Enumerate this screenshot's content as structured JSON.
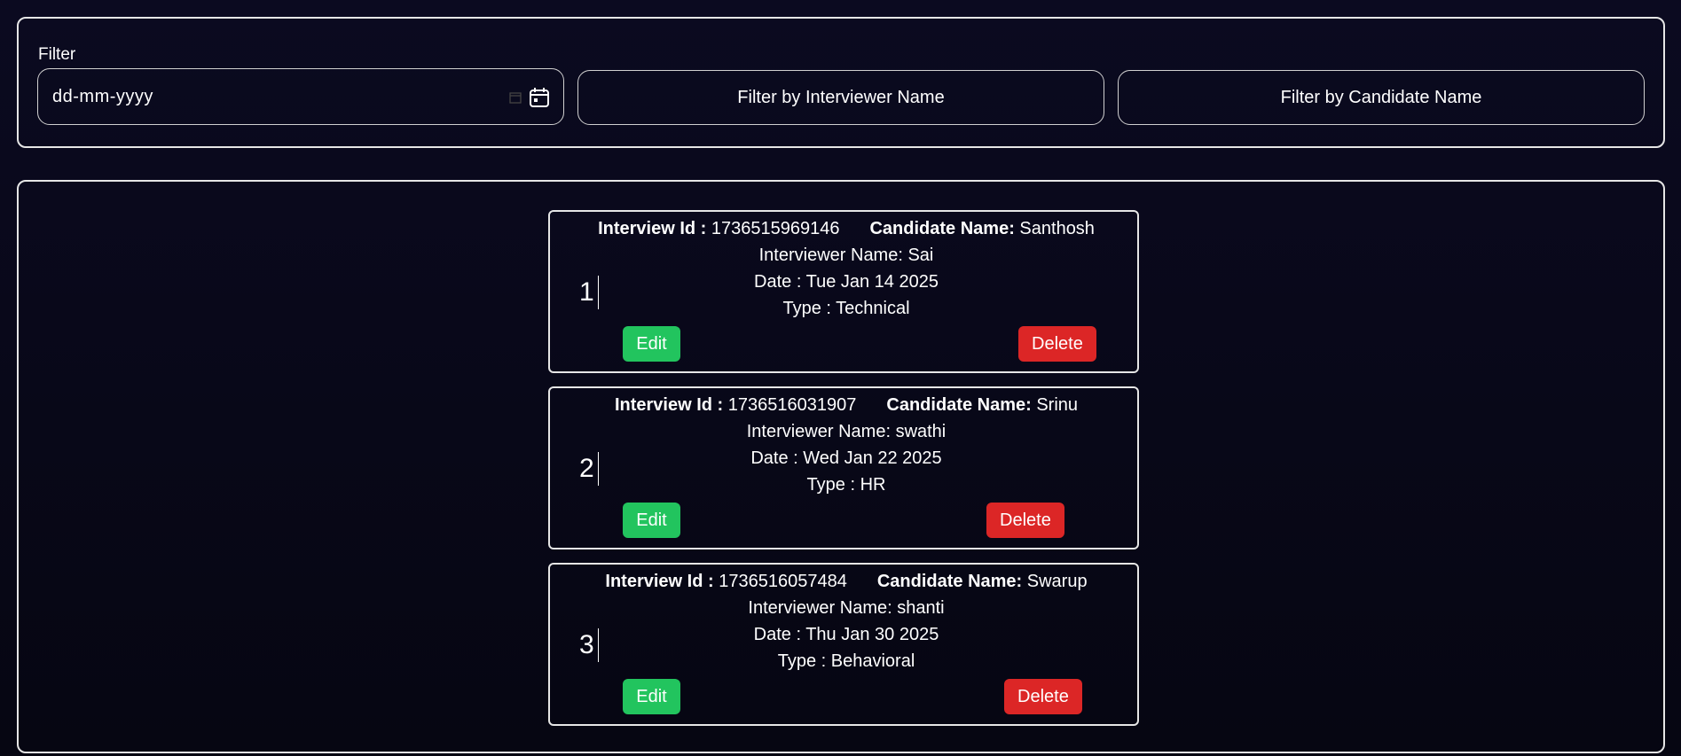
{
  "filter": {
    "label": "Filter",
    "date_placeholder": "dd-mm-yyyy",
    "interviewer_placeholder": "Filter by Interviewer Name",
    "candidate_placeholder": "Filter by Candidate Name"
  },
  "labels": {
    "interview_id": "Interview Id :",
    "candidate_name": "Candidate Name:",
    "interviewer_name": "Interviewer Name:",
    "date": "Date :",
    "type": "Type :",
    "edit": "Edit",
    "delete": "Delete"
  },
  "interviews": [
    {
      "index": "1",
      "id": "1736515969146",
      "candidate": "Santhosh",
      "interviewer": "Sai",
      "date": "Tue Jan 14 2025",
      "type": "Technical"
    },
    {
      "index": "2",
      "id": "1736516031907",
      "candidate": "Srinu",
      "interviewer": "swathi",
      "date": "Wed Jan 22 2025",
      "type": "HR"
    },
    {
      "index": "3",
      "id": "1736516057484",
      "candidate": "Swarup",
      "interviewer": "shanti",
      "date": "Thu Jan 30 2025",
      "type": "Behavioral"
    }
  ],
  "colors": {
    "edit": "#22c45e",
    "delete": "#dc2626",
    "background": "#0b0a20",
    "border": "#e6e6e6"
  },
  "icons": {
    "date_picker": "calendar-icon"
  }
}
